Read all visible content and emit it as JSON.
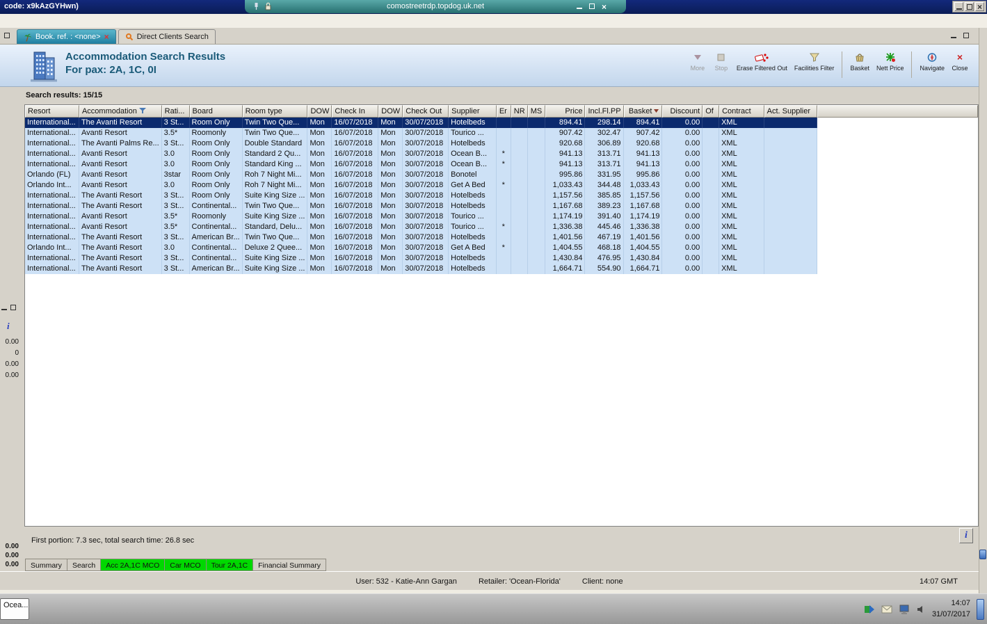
{
  "window": {
    "code_label": "code: x9kAzGYHwn)",
    "rdp_host": "comostreetrdp.topdog.uk.net"
  },
  "doc_tabs": [
    {
      "label": "Book. ref. : <none>"
    },
    {
      "label": "Direct Clients Search"
    }
  ],
  "header": {
    "title": "Accommodation Search Results",
    "subtitle": "For pax: 2A, 1C, 0I",
    "toolbar": [
      {
        "label": "More",
        "disabled": true
      },
      {
        "label": "Stop",
        "disabled": true
      },
      {
        "label": "Erase Filtered Out"
      },
      {
        "label": "Facilities Filter"
      },
      {
        "label": "Basket"
      },
      {
        "label": "Nett Price"
      },
      {
        "label": "Navigate"
      },
      {
        "label": "Close"
      }
    ]
  },
  "results": {
    "summary": "Search results: 15/15",
    "columns": [
      "Resort",
      "Accommodation",
      "Rati...",
      "Board",
      "Room type",
      "DOW",
      "Check In",
      "DOW",
      "Check Out",
      "Supplier",
      "Er",
      "NR",
      "MS",
      "Price",
      "Incl.Fl.PP",
      "Basket",
      "Discount",
      "Of",
      "Contract",
      "Act. Supplier"
    ],
    "rows": [
      [
        "International...",
        "The Avanti Resort",
        "3 St...",
        "Room Only",
        "Twin Two Que...",
        "Mon",
        "16/07/2018",
        "Mon",
        "30/07/2018",
        "Hotelbeds",
        "",
        "",
        "",
        "894.41",
        "298.14",
        "894.41",
        "0.00",
        "",
        "XML",
        ""
      ],
      [
        "International...",
        "Avanti Resort",
        "3.5*",
        "Roomonly",
        "Twin Two Que...",
        "Mon",
        "16/07/2018",
        "Mon",
        "30/07/2018",
        "Tourico ...",
        "",
        "",
        "",
        "907.42",
        "302.47",
        "907.42",
        "0.00",
        "",
        "XML",
        ""
      ],
      [
        "International...",
        "The Avanti Palms Re...",
        "3 St...",
        "Room Only",
        "Double Standard",
        "Mon",
        "16/07/2018",
        "Mon",
        "30/07/2018",
        "Hotelbeds",
        "",
        "",
        "",
        "920.68",
        "306.89",
        "920.68",
        "0.00",
        "",
        "XML",
        ""
      ],
      [
        "International...",
        "Avanti Resort",
        "3.0",
        "Room Only",
        "Standard 2 Qu...",
        "Mon",
        "16/07/2018",
        "Mon",
        "30/07/2018",
        "Ocean B...",
        "*",
        "",
        "",
        "941.13",
        "313.71",
        "941.13",
        "0.00",
        "",
        "XML",
        ""
      ],
      [
        "International...",
        "Avanti Resort",
        "3.0",
        "Room Only",
        "Standard King ...",
        "Mon",
        "16/07/2018",
        "Mon",
        "30/07/2018",
        "Ocean B...",
        "*",
        "",
        "",
        "941.13",
        "313.71",
        "941.13",
        "0.00",
        "",
        "XML",
        ""
      ],
      [
        "Orlando (FL)",
        "Avanti Resort",
        "3star",
        "Room Only",
        "Roh 7 Night Mi...",
        "Mon",
        "16/07/2018",
        "Mon",
        "30/07/2018",
        "Bonotel",
        "",
        "",
        "",
        "995.86",
        "331.95",
        "995.86",
        "0.00",
        "",
        "XML",
        ""
      ],
      [
        "Orlando Int...",
        "Avanti Resort",
        "3.0",
        "Room Only",
        "Roh 7 Night Mi...",
        "Mon",
        "16/07/2018",
        "Mon",
        "30/07/2018",
        "Get A Bed",
        "*",
        "",
        "",
        "1,033.43",
        "344.48",
        "1,033.43",
        "0.00",
        "",
        "XML",
        ""
      ],
      [
        "International...",
        "The Avanti Resort",
        "3 St...",
        "Room Only",
        "Suite King Size ...",
        "Mon",
        "16/07/2018",
        "Mon",
        "30/07/2018",
        "Hotelbeds",
        "",
        "",
        "",
        "1,157.56",
        "385.85",
        "1,157.56",
        "0.00",
        "",
        "XML",
        ""
      ],
      [
        "International...",
        "The Avanti Resort",
        "3 St...",
        "Continental...",
        "Twin Two Que...",
        "Mon",
        "16/07/2018",
        "Mon",
        "30/07/2018",
        "Hotelbeds",
        "",
        "",
        "",
        "1,167.68",
        "389.23",
        "1,167.68",
        "0.00",
        "",
        "XML",
        ""
      ],
      [
        "International...",
        "Avanti Resort",
        "3.5*",
        "Roomonly",
        "Suite King Size ...",
        "Mon",
        "16/07/2018",
        "Mon",
        "30/07/2018",
        "Tourico ...",
        "",
        "",
        "",
        "1,174.19",
        "391.40",
        "1,174.19",
        "0.00",
        "",
        "XML",
        ""
      ],
      [
        "International...",
        "Avanti Resort",
        "3.5*",
        "Continental...",
        "Standard, Delu...",
        "Mon",
        "16/07/2018",
        "Mon",
        "30/07/2018",
        "Tourico ...",
        "*",
        "",
        "",
        "1,336.38",
        "445.46",
        "1,336.38",
        "0.00",
        "",
        "XML",
        ""
      ],
      [
        "International...",
        "The Avanti Resort",
        "3 St...",
        "American Br...",
        "Twin Two Que...",
        "Mon",
        "16/07/2018",
        "Mon",
        "30/07/2018",
        "Hotelbeds",
        "",
        "",
        "",
        "1,401.56",
        "467.19",
        "1,401.56",
        "0.00",
        "",
        "XML",
        ""
      ],
      [
        "Orlando Int...",
        "The Avanti Resort",
        "3.0",
        "Continental...",
        "Deluxe 2 Quee...",
        "Mon",
        "16/07/2018",
        "Mon",
        "30/07/2018",
        "Get A Bed",
        "*",
        "",
        "",
        "1,404.55",
        "468.18",
        "1,404.55",
        "0.00",
        "",
        "XML",
        ""
      ],
      [
        "International...",
        "The Avanti Resort",
        "3 St...",
        "Continental...",
        "Suite King Size ...",
        "Mon",
        "16/07/2018",
        "Mon",
        "30/07/2018",
        "Hotelbeds",
        "",
        "",
        "",
        "1,430.84",
        "476.95",
        "1,430.84",
        "0.00",
        "",
        "XML",
        ""
      ],
      [
        "International...",
        "The Avanti Resort",
        "3 St...",
        "American Br...",
        "Suite King Size ...",
        "Mon",
        "16/07/2018",
        "Mon",
        "30/07/2018",
        "Hotelbeds",
        "",
        "",
        "",
        "1,664.71",
        "554.90",
        "1,664.71",
        "0.00",
        "",
        "XML",
        ""
      ]
    ]
  },
  "footer": {
    "timing": "First portion: 7.3 sec, total search time: 26.8 sec",
    "info_icon": "i",
    "bottom_tabs": [
      {
        "label": "Summary"
      },
      {
        "label": "Search"
      },
      {
        "label": "Acc 2A,1C MCO",
        "green": true
      },
      {
        "label": "Car MCO",
        "green": true
      },
      {
        "label": "Tour 2A,1C",
        "green": true
      },
      {
        "label": "Financial Summary"
      }
    ],
    "status_parts": [
      "User: 532 - Katie-Ann Gargan",
      "Retailer: 'Ocean-Florida'",
      "Client: none"
    ],
    "time_gmt": "14:07 GMT"
  },
  "left_panel": {
    "info_icon": "i",
    "values": [
      "0.00",
      "0",
      "0.00",
      "0.00"
    ],
    "totals": [
      "0.00",
      "0.00",
      "0.00"
    ]
  },
  "taskbar": {
    "app_button": "Ocea...",
    "time": "14:07",
    "date": "31/07/2017"
  },
  "colors": {
    "selection": "#0b2a6e",
    "row_blue": "#cde1f6",
    "tab_green": "#00d800",
    "title_teal": "#1a5a78"
  }
}
